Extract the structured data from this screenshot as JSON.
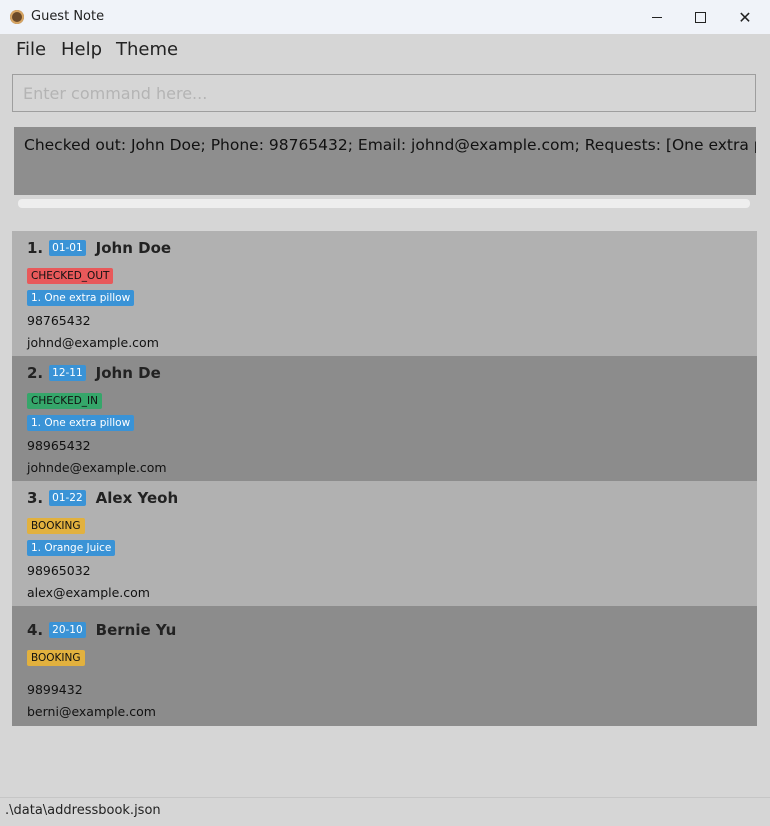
{
  "window": {
    "title": "Guest Note",
    "minimize_icon": "minimize-icon",
    "maximize_icon": "maximize-icon",
    "close_icon": "close-icon"
  },
  "menu": {
    "file": "File",
    "help": "Help",
    "theme": "Theme"
  },
  "command": {
    "placeholder": "Enter command here..."
  },
  "result": {
    "text": "Checked out: John Doe; Phone: 98765432; Email: johnd@example.com; Requests: [One extra pillow]"
  },
  "guests": [
    {
      "index": "1.",
      "room": "01-01",
      "name": "John Doe",
      "status": "CHECKED_OUT",
      "request": "1. One extra pillow",
      "phone": "98765432",
      "email": "johnd@example.com"
    },
    {
      "index": "2.",
      "room": "12-11",
      "name": "John De",
      "status": "CHECKED_IN",
      "request": "1. One extra pillow",
      "phone": "98965432",
      "email": "johnde@example.com"
    },
    {
      "index": "3.",
      "room": "01-22",
      "name": "Alex Yeoh",
      "status": "BOOKING",
      "request": "1. Orange Juice",
      "phone": "98965032",
      "email": "alex@example.com"
    },
    {
      "index": "4.",
      "room": "20-10",
      "name": "Bernie Yu",
      "status": "BOOKING",
      "phone": "9899432",
      "email": "berni@example.com"
    }
  ],
  "status_bar": {
    "path": ".\\data\\addressbook.json"
  },
  "colors": {
    "checked_out": "#e8595a",
    "checked_in": "#35a66a",
    "booking": "#e2b13e",
    "tag_blue": "#3a93d6"
  }
}
